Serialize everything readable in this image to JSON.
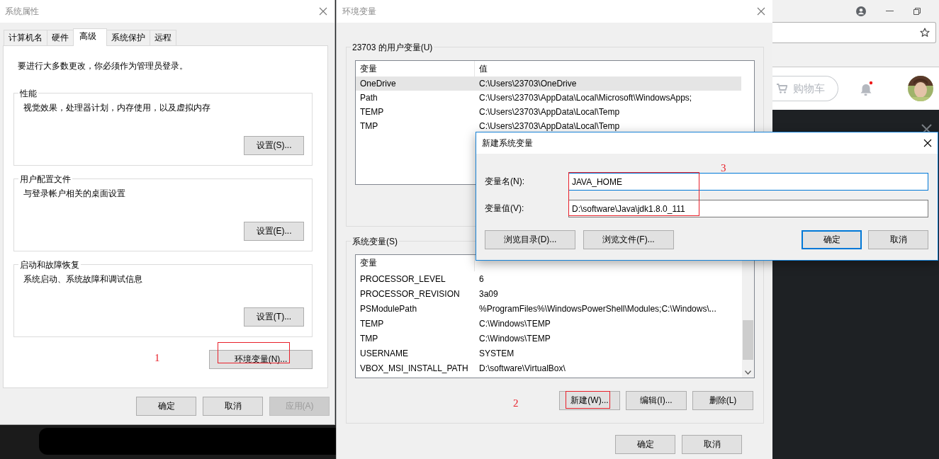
{
  "browser": {
    "cart_button": "购物车"
  },
  "system_properties": {
    "title": "系统属性",
    "tabs": [
      {
        "label": "计算机名",
        "selected": false
      },
      {
        "label": "硬件",
        "selected": false
      },
      {
        "label": "高级",
        "selected": true
      },
      {
        "label": "系统保护",
        "selected": false
      },
      {
        "label": "远程",
        "selected": false
      }
    ],
    "admin_note": "要进行大多数更改，你必须作为管理员登录。",
    "groups": [
      {
        "title": "性能",
        "description": "视觉效果，处理器计划，内存使用，以及虚拟内存",
        "button": "设置(S)..."
      },
      {
        "title": "用户配置文件",
        "description": "与登录帐户相关的桌面设置",
        "button": "设置(E)..."
      },
      {
        "title": "启动和故障恢复",
        "description": "系统启动、系统故障和调试信息",
        "button": "设置(T)..."
      }
    ],
    "env_button": "环境变量(N)...",
    "buttons": [
      {
        "label": "确定",
        "disabled": false
      },
      {
        "label": "取消",
        "disabled": false
      },
      {
        "label": "应用(A)",
        "disabled": true
      }
    ]
  },
  "environment_variables": {
    "title": "环境变量",
    "user_group": {
      "title": "23703 的用户变量(U)",
      "columns": [
        "变量",
        "值"
      ],
      "rows": [
        {
          "name": "OneDrive",
          "value": "C:\\Users\\23703\\OneDrive",
          "selected": true
        },
        {
          "name": "Path",
          "value": "C:\\Users\\23703\\AppData\\Local\\Microsoft\\WindowsApps;",
          "selected": false
        },
        {
          "name": "TEMP",
          "value": "C:\\Users\\23703\\AppData\\Local\\Temp",
          "selected": false
        },
        {
          "name": "TMP",
          "value": "C:\\Users\\23703\\AppData\\Local\\Temp",
          "selected": false
        }
      ]
    },
    "system_group": {
      "title": "系统变量(S)",
      "columns": [
        "变量"
      ],
      "rows": [
        {
          "name": "PROCESSOR_LEVEL",
          "value": "6",
          "selected": false
        },
        {
          "name": "PROCESSOR_REVISION",
          "value": "3a09",
          "selected": false
        },
        {
          "name": "PSModulePath",
          "value": "%ProgramFiles%\\WindowsPowerShell\\Modules;C:\\Windows\\...",
          "selected": false
        },
        {
          "name": "TEMP",
          "value": "C:\\Windows\\TEMP",
          "selected": false
        },
        {
          "name": "TMP",
          "value": "C:\\Windows\\TEMP",
          "selected": false
        },
        {
          "name": "USERNAME",
          "value": "SYSTEM",
          "selected": false
        },
        {
          "name": "VBOX_MSI_INSTALL_PATH",
          "value": "D:\\software\\VirtualBox\\",
          "selected": false
        }
      ],
      "buttons": [
        "新建(W)...",
        "编辑(I)...",
        "删除(L)"
      ]
    },
    "buttons": [
      "确定",
      "取消"
    ]
  },
  "new_variable_dialog": {
    "title": "新建系统变量",
    "fields": [
      {
        "label": "变量名(N):",
        "value": "JAVA_HOME",
        "focused": true
      },
      {
        "label": "变量值(V):",
        "value": "D:\\software\\Java\\jdk1.8.0_111",
        "focused": false
      }
    ],
    "browse_buttons": [
      "浏览目录(D)...",
      "浏览文件(F)..."
    ],
    "buttons": [
      {
        "label": "确定",
        "default": true
      },
      {
        "label": "取消",
        "default": false
      }
    ]
  },
  "annotations": [
    {
      "label": "1"
    },
    {
      "label": "2"
    },
    {
      "label": "3"
    }
  ]
}
